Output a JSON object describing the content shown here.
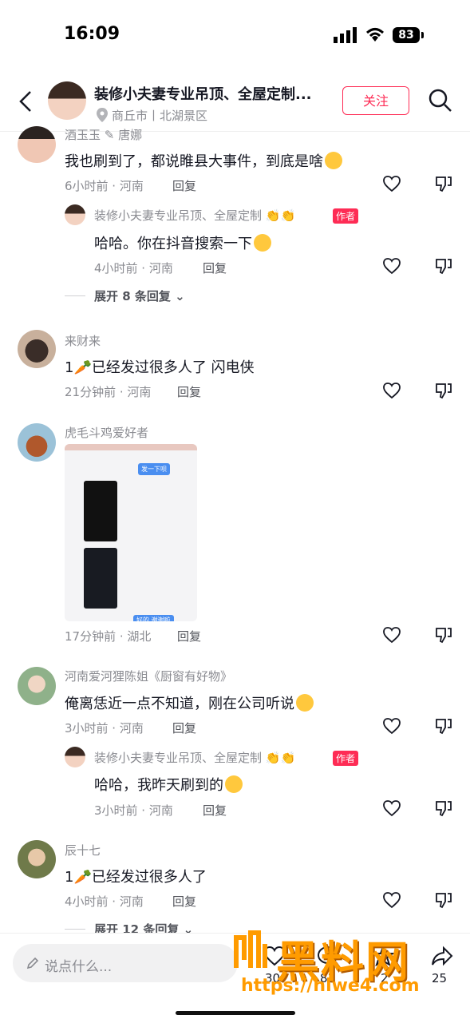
{
  "status_bar": {
    "time": "16:09",
    "battery": "83"
  },
  "header": {
    "title": "装修小夫妻专业吊顶、全屋定制...",
    "location": "商丘市丨北湖景区",
    "follow_label": "关注"
  },
  "comments": [
    {
      "name": "酒玉玉 ✎ 唐娜",
      "text": "我也刷到了，都说睢县大事件，到底是啥",
      "time": "6小时前 · 河南",
      "reply_label": "回复",
      "sub_reply": {
        "name": "装修小夫妻专业吊顶、全屋定制",
        "badge": "作者",
        "text": "哈哈。你在抖音搜索一下",
        "time": "4小时前 · 河南",
        "reply_label": "回复"
      },
      "expand": "展开 8 条回复"
    },
    {
      "name": "来财来",
      "text": "1🥕已经发过很多人了 闪电侠",
      "time": "21分钟前 · 河南",
      "reply_label": "回复"
    },
    {
      "name": "虎毛斗鸡爱好者",
      "image_inner_texts": [
        "发一下呗",
        "好的 谢谢啦"
      ],
      "time": "17分钟前 · 湖北",
      "reply_label": "回复"
    },
    {
      "name": "河南爱河狸陈姐《厨窗有好物》",
      "text": "俺离恁近一点不知道，刚在公司听说",
      "time": "3小时前 · 河南",
      "reply_label": "回复",
      "sub_reply": {
        "name": "装修小夫妻专业吊顶、全屋定制",
        "badge": "作者",
        "text": "哈哈，我昨天刷到的",
        "time": "3小时前 · 河南",
        "reply_label": "回复"
      }
    },
    {
      "name": "辰十七",
      "text": "1🥕已经发过很多人了",
      "time": "4小时前 · 河南",
      "reply_label": "回复",
      "expand": "展开 12 条回复"
    }
  ],
  "bottom_bar": {
    "input_placeholder": "说点什么...",
    "like_count": "30",
    "comment_count": "83",
    "star_count": "2",
    "share_count": "25"
  },
  "watermark": {
    "text": "黑料网",
    "url": "https://hlwe4.com"
  },
  "colors": {
    "accent": "#fe2c55",
    "meta": "#8a8b91",
    "text": "#161823"
  }
}
